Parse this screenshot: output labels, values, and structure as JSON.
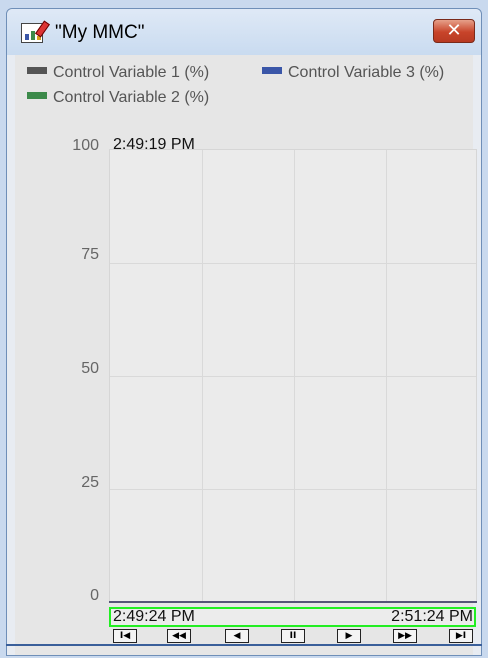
{
  "window": {
    "title": "\"My MMC\"",
    "close_glyph": "✕"
  },
  "legend": [
    {
      "label": "Control Variable 1 (%)",
      "color": "#555555"
    },
    {
      "label": "Control Variable 3 (%)",
      "color": "#3a56a8"
    },
    {
      "label": "Control Variable 2 (%)",
      "color": "#3c8a4a"
    }
  ],
  "chart": {
    "y_ticks": [
      "100",
      "75",
      "50",
      "25",
      "0"
    ],
    "start_time": "2:49:19 PM"
  },
  "time_range": {
    "from": "2:49:24 PM",
    "to": "2:51:24 PM",
    "highlight_color": "#22ee22"
  },
  "navigation": [
    {
      "glyph": "I◀",
      "icon": "jump-to-start-icon"
    },
    {
      "glyph": "◀◀",
      "icon": "fast-rewind-icon"
    },
    {
      "glyph": "◀",
      "icon": "step-back-icon"
    },
    {
      "glyph": "II",
      "icon": "pause-icon"
    },
    {
      "glyph": "▶",
      "icon": "step-forward-icon"
    },
    {
      "glyph": "▶▶",
      "icon": "fast-forward-icon"
    },
    {
      "glyph": "▶I",
      "icon": "jump-to-end-icon"
    }
  ]
}
